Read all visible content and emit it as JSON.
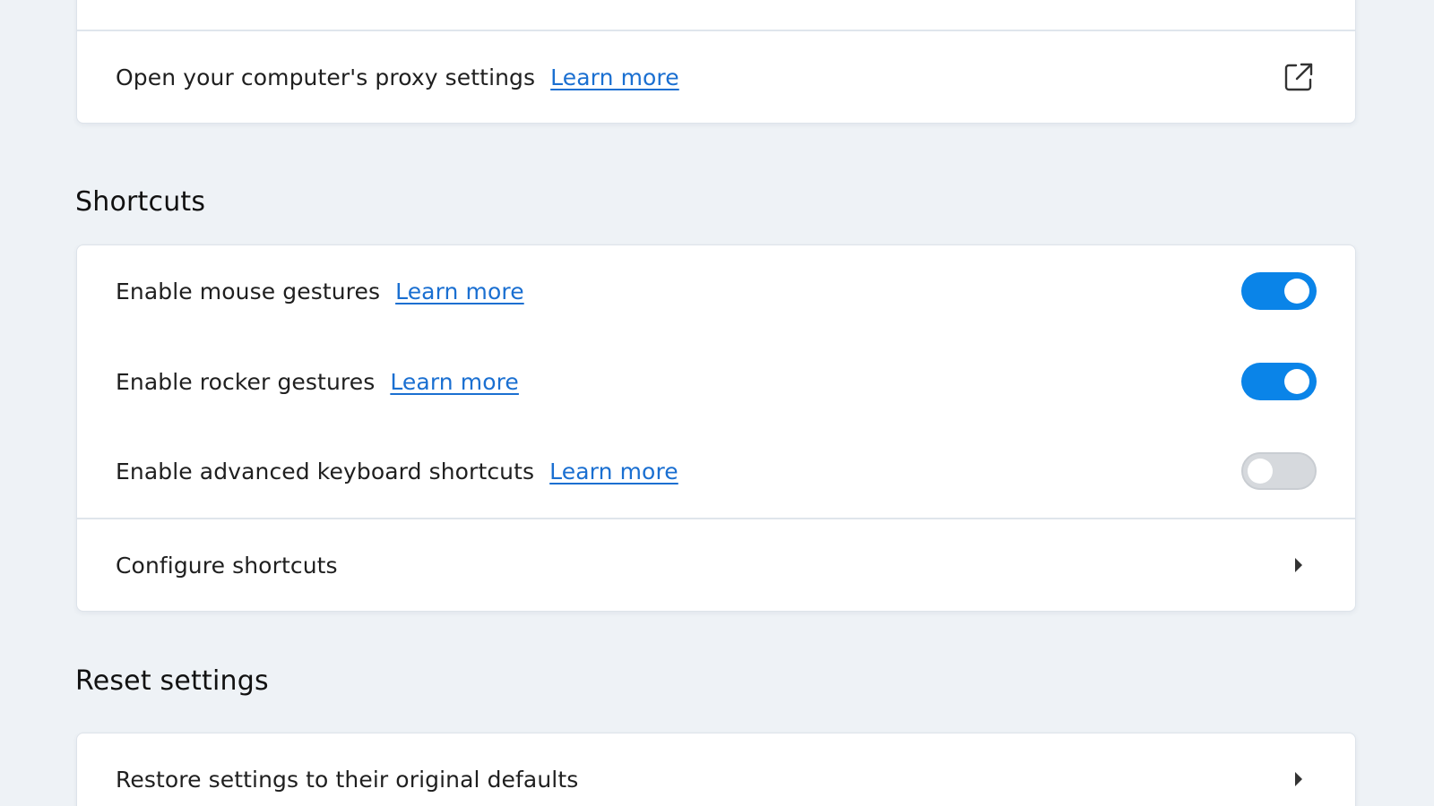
{
  "proxy": {
    "label": "Open your computer's proxy settings",
    "link": "Learn more",
    "icon": "external-link-icon"
  },
  "shortcuts": {
    "title": "Shortcuts",
    "items": [
      {
        "label": "Enable mouse gestures",
        "link": "Learn more",
        "enabled": true
      },
      {
        "label": "Enable rocker gestures",
        "link": "Learn more",
        "enabled": true
      },
      {
        "label": "Enable advanced keyboard shortcuts",
        "link": "Learn more",
        "enabled": false
      }
    ],
    "configure": {
      "label": "Configure shortcuts",
      "icon": "chevron-right-icon"
    }
  },
  "reset": {
    "title": "Reset settings",
    "restore": {
      "label": "Restore settings to their original defaults",
      "icon": "chevron-right-icon"
    }
  },
  "colors": {
    "accent": "#0a84e8",
    "link": "#1a6fd1",
    "background": "#eef2f6",
    "toggle_off": "#d6d9dd"
  }
}
